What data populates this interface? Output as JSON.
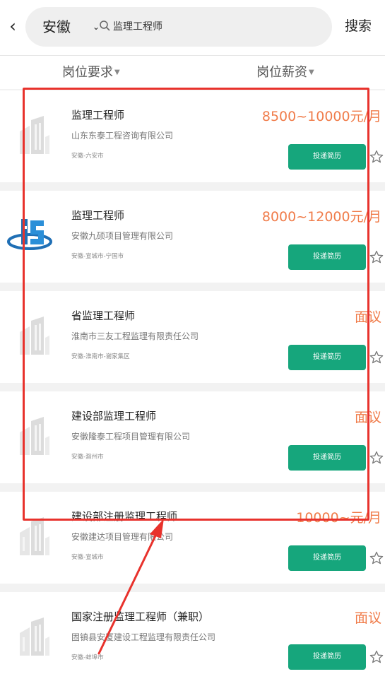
{
  "header": {
    "back_glyph": "‹",
    "city": "安徽",
    "search_query": "监理工程师",
    "search_button": "搜索"
  },
  "filters": {
    "requirement": "岗位要求",
    "salary": "岗位薪资"
  },
  "apply_label": "投递简历",
  "colors": {
    "accent_green": "#16a67c",
    "salary_orange": "#f07c4a",
    "annotation_red": "#e8322c"
  },
  "jobs": [
    {
      "title": "监理工程师",
      "company": "山东东泰工程咨询有限公司",
      "location": "安徽-六安市",
      "salary": "8500~10000元/月",
      "logo": "building-placeholder-icon"
    },
    {
      "title": "监理工程师",
      "company": "安徽九硕项目管理有限公司",
      "location": "安徽-宣城市-宁国市",
      "salary": "8000~12000元/月",
      "logo": "company-logo-js"
    },
    {
      "title": "省监理工程师",
      "company": "淮南市三友工程监理有限责任公司",
      "location": "安徽-淮南市-谢家集区",
      "salary": "面议",
      "logo": "building-placeholder-icon"
    },
    {
      "title": "建设部监理工程师",
      "company": "安徽隆泰工程项目管理有限公司",
      "location": "安徽-滁州市",
      "salary": "面议",
      "logo": "building-placeholder-icon"
    },
    {
      "title": "建设部注册监理工程师",
      "company": "安徽建达项目管理有限公司",
      "location": "安徽-宣城市",
      "salary": "10000~元/月",
      "logo": "building-placeholder-icon"
    },
    {
      "title": "国家注册监理工程师（兼职）",
      "company": "固镇县安厦建设工程监理有限责任公司",
      "location": "安徽-蚌埠市",
      "salary": "面议",
      "logo": "building-placeholder-icon"
    }
  ]
}
